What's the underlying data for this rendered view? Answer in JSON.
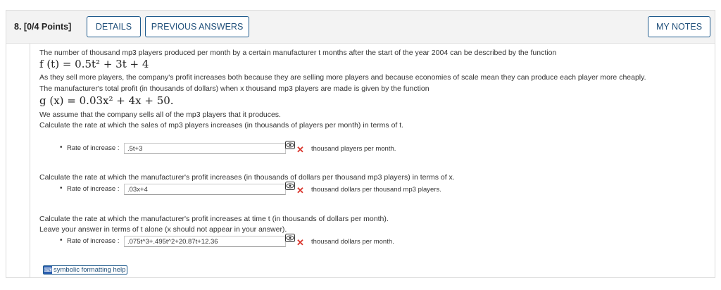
{
  "question": {
    "number_label": "8.",
    "points_label": "[0/4 Points]",
    "buttons": {
      "details": "DETAILS",
      "previous_answers": "PREVIOUS ANSWERS",
      "my_notes": "MY NOTES"
    }
  },
  "problem": {
    "intro": "The number of thousand mp3 players produced per month by a certain manufacturer t months after the start of the year 2004 can be described by the function",
    "f_func": "f (t) = 0.5t² + 3t + 4",
    "profit_text_1": "As they sell more players, the company's profit increases both because they are selling more players and because economies of scale mean they can produce each player more cheaply.",
    "profit_text_2": "The manufacturer's total profit (in thousands of dollars) when x thousand mp3 players are made is given by the function",
    "g_func": "g (x) = 0.03x² + 4x + 50.",
    "assume_text": "We assume that the company sells all of the mp3 players that it produces.",
    "part1_prompt": "Calculate the rate at which the sales of mp3 players increases (in thousands of players per month) in terms of t.",
    "part2_prompt": "Calculate the rate at which the manufacturer's profit increases (in thousands of dollars per thousand mp3 players) in terms of x.",
    "part3_prompt_1": "Calculate the rate at which the manufacturer's profit increases at time t (in thousands of dollars per month).",
    "part3_prompt_2": "Leave your answer in terms of t alone (x should not appear in your answer)."
  },
  "answers": [
    {
      "label": "Rate of increase :",
      "value": ".5t+3",
      "unit": "thousand players per month.",
      "status": "incorrect"
    },
    {
      "label": "Rate of increase :",
      "value": ".03x+4",
      "unit": "thousand dollars per thousand mp3 players.",
      "status": "incorrect"
    },
    {
      "label": "Rate of increase :",
      "value": ".075t^3+.495t^2+20.87t+12.36",
      "unit": "thousand dollars per month.",
      "status": "incorrect"
    }
  ],
  "help_link": "symbolic formatting help",
  "colors": {
    "accent": "#1f5a8c",
    "incorrect": "#d9342b",
    "header_bg": "#f3f3f3"
  },
  "icons": {
    "preview": "eye-icon",
    "incorrect": "x-icon",
    "help": "keyboard-icon"
  }
}
